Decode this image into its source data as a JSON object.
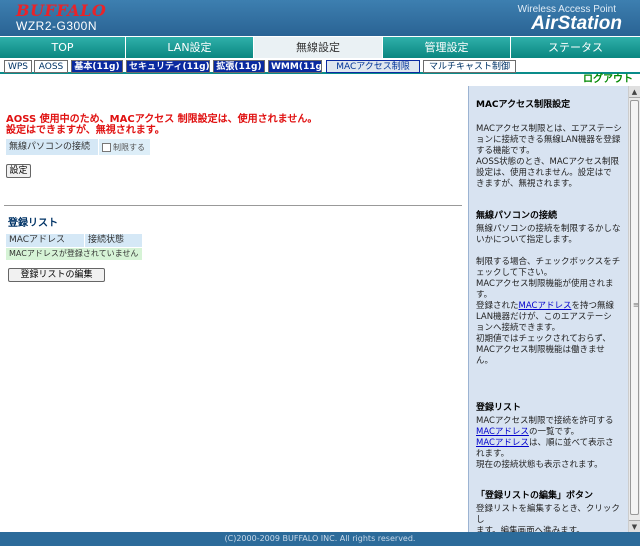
{
  "header": {
    "logo": "BUFFALO",
    "model": "WZR2-G300N",
    "product_caption": "Wireless Access Point",
    "product_name": "AirStation"
  },
  "main_nav": [
    {
      "label": "TOP",
      "active": false
    },
    {
      "label": "LAN設定",
      "active": false
    },
    {
      "label": "無線設定",
      "active": true
    },
    {
      "label": "管理設定",
      "active": false
    },
    {
      "label": "ステータス",
      "active": false
    }
  ],
  "sub_nav": [
    {
      "label": "WPS",
      "style": "plain"
    },
    {
      "label": "AOSS",
      "style": "plain"
    },
    {
      "label": "基本(11g)",
      "style": "dark"
    },
    {
      "label": "セキュリティ(11g)",
      "style": "dark"
    },
    {
      "label": "拡張(11g)",
      "style": "dark"
    },
    {
      "label": "WMM(11g)",
      "style": "dark"
    },
    {
      "label": "MACアクセス制限",
      "style": "active"
    },
    {
      "label": "マルチキャスト制御",
      "style": "plain"
    }
  ],
  "logout": "ログアウト",
  "content": {
    "warning_line1": "AOSS 使用中のため、MACアクセス 制限設定は、使用されません。",
    "warning_line2": "設定はできますが、無視されます。",
    "connection_label": "無線パソコンの接続",
    "connection_checkbox_label": "制限する",
    "connection_checked": false,
    "set_button": "設定",
    "registration_title": "登録リスト",
    "table_headers": [
      "MACアドレス",
      "接続状態"
    ],
    "empty_message": "MACアドレスが登録されていません",
    "edit_button": "登録リストの編集"
  },
  "help": {
    "section1_title": "MACアクセス制限設定",
    "section1_lines": [
      "MACアクセス制限とは、エアステーシ",
      "ョンに接続できる無線LAN機器を登録",
      "する機能です。",
      "AOSS状態のとき、MACアクセス制限",
      "設定は、使用されません。設定はで",
      "きますが、無視されます。"
    ],
    "section2_title": "無線パソコンの接続",
    "section2_lines": [
      "無線パソコンの接続を制限するかしな",
      "いかについて指定します。"
    ],
    "section3_lines_a": [
      "制限する場合、チェックボックスをチ",
      "ェックして下さい。",
      "MACアクセス制限機能が使用されま",
      "す。"
    ],
    "section3_pre_link": "登録された",
    "section3_link": "MACアドレス",
    "section3_post_link": "を持つ無線",
    "section3_lines_b": [
      "LAN機器だけが、このエアステーシ",
      "ョンへ接続できます。",
      "初期値ではチェックされておらず、",
      "MACアクセス制限機能は働きませ",
      "ん。"
    ],
    "section4_title": "登録リスト",
    "section4_line1": "MACアクセス制限で接続を許可する",
    "section4_link1": "MACアドレス",
    "section4_line2_post": "の一覧です。",
    "section4_link2": "MACアドレス",
    "section4_line3_post": "は、順に並べて表示さ",
    "section4_lines_rest": [
      "れます。",
      "現在の接続状態も表示されます。"
    ],
    "section5_title": "「登録リストの編集」ボタン",
    "section5_lines": [
      "登録リストを編集するとき、クリックし",
      "ます。編集画面へ進みます。"
    ]
  },
  "footer": "(C)2000-2009 BUFFALO INC. All rights reserved.",
  "colors": {
    "header_blue": "#2a6394",
    "nav_teal": "#0a8c8a",
    "warning_red": "#e01010",
    "logout_green": "#008800",
    "help_bg": "#d8e3f1"
  }
}
